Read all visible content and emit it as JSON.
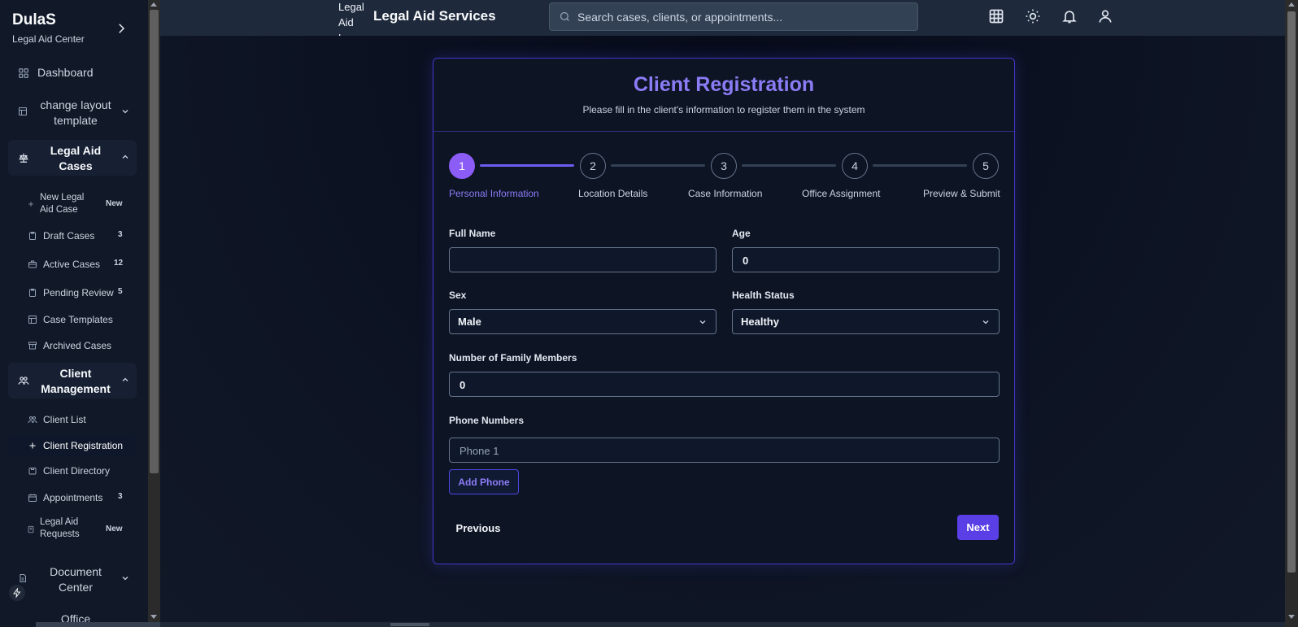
{
  "sidebar": {
    "brand_name": "DulaS",
    "brand_sub": "Legal Aid Center",
    "dashboard": "Dashboard",
    "change_layout": "change layout template",
    "legal_aid_cases": "Legal Aid Cases",
    "cases_items": [
      {
        "label": "New Legal Aid Case",
        "badge": "New",
        "icon": "plus-icon"
      },
      {
        "label": "Draft Cases",
        "badge": "3",
        "icon": "clipboard-icon"
      },
      {
        "label": "Active Cases",
        "badge": "12",
        "icon": "briefcase-icon"
      },
      {
        "label": "Pending Review",
        "badge": "5",
        "icon": "clipboard-icon"
      },
      {
        "label": "Case Templates",
        "badge": "",
        "icon": "template-icon"
      },
      {
        "label": "Archived Cases",
        "badge": "",
        "icon": "archive-icon"
      }
    ],
    "client_management": "Client Management",
    "client_items": [
      {
        "label": "Client List",
        "badge": "",
        "icon": "users-icon"
      },
      {
        "label": "Client Registration",
        "badge": "",
        "icon": "plus-icon"
      },
      {
        "label": "Client Directory",
        "badge": "",
        "icon": "folder-icon"
      },
      {
        "label": "Appointments",
        "badge": "3",
        "icon": "calendar-icon"
      },
      {
        "label": "Legal Aid Requests",
        "badge": "New",
        "icon": "file-icon"
      }
    ],
    "document_center": "Document Center",
    "office": "Office"
  },
  "header": {
    "logo_alt": "Legal Aid Logo",
    "title": "Legal Aid Services",
    "search_placeholder": "Search cases, clients, or appointments..."
  },
  "form": {
    "title": "Client Registration",
    "subtitle": "Please fill in the client's information to register them in the system",
    "steps": [
      {
        "number": "1",
        "label": "Personal Information"
      },
      {
        "number": "2",
        "label": "Location Details"
      },
      {
        "number": "3",
        "label": "Case Information"
      },
      {
        "number": "4",
        "label": "Office Assignment"
      },
      {
        "number": "5",
        "label": "Preview & Submit"
      }
    ],
    "full_name_label": "Full Name",
    "full_name_value": "",
    "age_label": "Age",
    "age_value": "0",
    "sex_label": "Sex",
    "sex_value": "Male",
    "health_label": "Health Status",
    "health_value": "Healthy",
    "family_label": "Number of Family Members",
    "family_value": "0",
    "phone_label": "Phone Numbers",
    "phone_placeholder": "Phone 1",
    "add_phone": "Add Phone",
    "previous": "Previous",
    "next": "Next"
  },
  "colors": {
    "accent": "#8b5cf6",
    "primary_button": "#5b3fe6",
    "background": "#0b1120"
  }
}
